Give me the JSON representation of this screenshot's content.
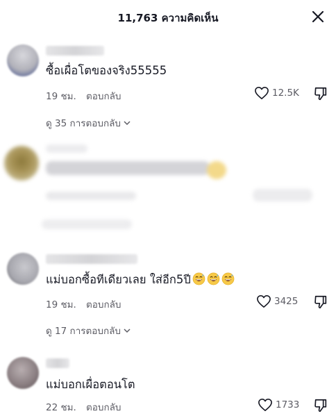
{
  "header": {
    "title": "11,763 ความคิดเห็น"
  },
  "comments": [
    {
      "text": "ซื้อเผื่อโตของจริง55555",
      "time": "19 ชม.",
      "reply_label": "ตอบกลับ",
      "likes": "12.5K",
      "view_replies": "ดู 35 การตอบกลับ"
    },
    {
      "text": "แม่บอกซื้อทีเดียวเลย ใส่อีก5ปี",
      "emoji_count": 3,
      "emoji_icon": "grinning-sweat-emoji",
      "time": "19 ชม.",
      "reply_label": "ตอบกลับ",
      "likes": "3425",
      "view_replies": "ดู 17 การตอบกลับ"
    },
    {
      "text": "แม่บอกเผื่อตอนโต",
      "time": "22 ชม.",
      "reply_label": "ตอบกลับ",
      "likes": "1733"
    }
  ],
  "icons": {
    "close": "close-icon",
    "like": "heart-icon",
    "dislike": "thumbs-down-icon",
    "expand": "chevron-down-icon"
  }
}
